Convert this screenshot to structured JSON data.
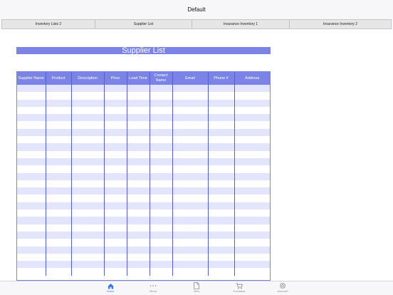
{
  "window": {
    "title": "Default"
  },
  "tabs": [
    {
      "label": "Inventory Lists 2"
    },
    {
      "label": "Supplier List"
    },
    {
      "label": "Insurance Inventory 1"
    },
    {
      "label": "Insurance Inventory 2"
    }
  ],
  "sheet": {
    "title": "Supplier List",
    "columns": [
      {
        "label": "Supplier Name"
      },
      {
        "label": "Product"
      },
      {
        "label": "Description"
      },
      {
        "label": "Price"
      },
      {
        "label": "Lead Time"
      },
      {
        "label": "Contact Name"
      },
      {
        "label": "Email"
      },
      {
        "label": "Phone #"
      },
      {
        "label": "Address"
      }
    ],
    "empty_rows": 26
  },
  "bottom_nav": [
    {
      "label": "Home",
      "icon": "home-icon",
      "active": true
    },
    {
      "label": "Menu",
      "icon": "more-icon",
      "active": false
    },
    {
      "label": "View",
      "icon": "document-icon",
      "active": false
    },
    {
      "label": "Purchase",
      "icon": "cart-icon",
      "active": false
    },
    {
      "label": "Account",
      "icon": "gear-icon",
      "active": false
    }
  ],
  "colors": {
    "header_fill": "#7b84e6",
    "stripe_fill": "#e2e5fb",
    "active_nav": "#3d7bd9"
  }
}
